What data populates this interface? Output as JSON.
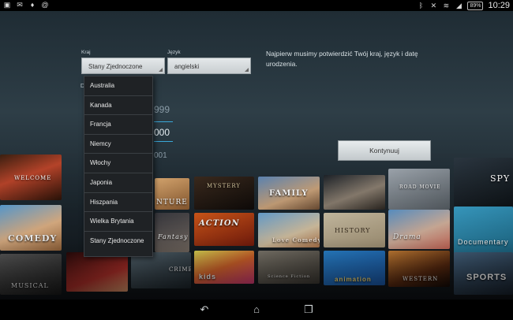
{
  "status_bar": {
    "left_icons": [
      "gallery-icon",
      "mail-icon",
      "twitter-icon",
      "at-icon"
    ],
    "right_icons": [
      "bluetooth-icon",
      "mute-icon",
      "wifi-icon",
      "signal-icon"
    ],
    "battery": "89%",
    "time": "10:29"
  },
  "form": {
    "country_label": "Kraj",
    "country_value": "Stany Zjednoczone",
    "language_label": "Język",
    "language_value": "angielski",
    "birth_label_partial": "D",
    "intro_text": "Najpierw musimy potwierdzić Twój kraj, język i datę urodzenia.",
    "continue_label": "Kontynuuj",
    "years": [
      "999",
      "000",
      "001"
    ]
  },
  "country_dropdown": {
    "options": [
      "Australia",
      "Kanada",
      "Francja",
      "Niemcy",
      "Włochy",
      "Japonia",
      "Hiszpania",
      "Wielka Brytania",
      "Stany Zjednoczone"
    ]
  },
  "posters": {
    "welcome": "WELCOME",
    "mystery": "MYSTERY",
    "family": "FAMILY",
    "road_movie": "ROAD MOVIE",
    "spy": "SPY",
    "comedy": "COMEDY",
    "fantasy": "Fantasy",
    "action": "ACTION",
    "love_comedy": "Love Comedy",
    "history": "HISTORY",
    "drama": "Drama",
    "documentary": "Documentary",
    "musical": "MUSICAL",
    "crime": "CRIME",
    "kids": "kids",
    "science_fiction": "Science Fiction",
    "animation": "animation",
    "western": "WESTERN",
    "sports": "SPORTS",
    "adventure_partial": "NTURE"
  },
  "nav_bar": {
    "back_icon": "back-icon",
    "home_icon": "home-icon",
    "recents_icon": "recents-icon"
  }
}
